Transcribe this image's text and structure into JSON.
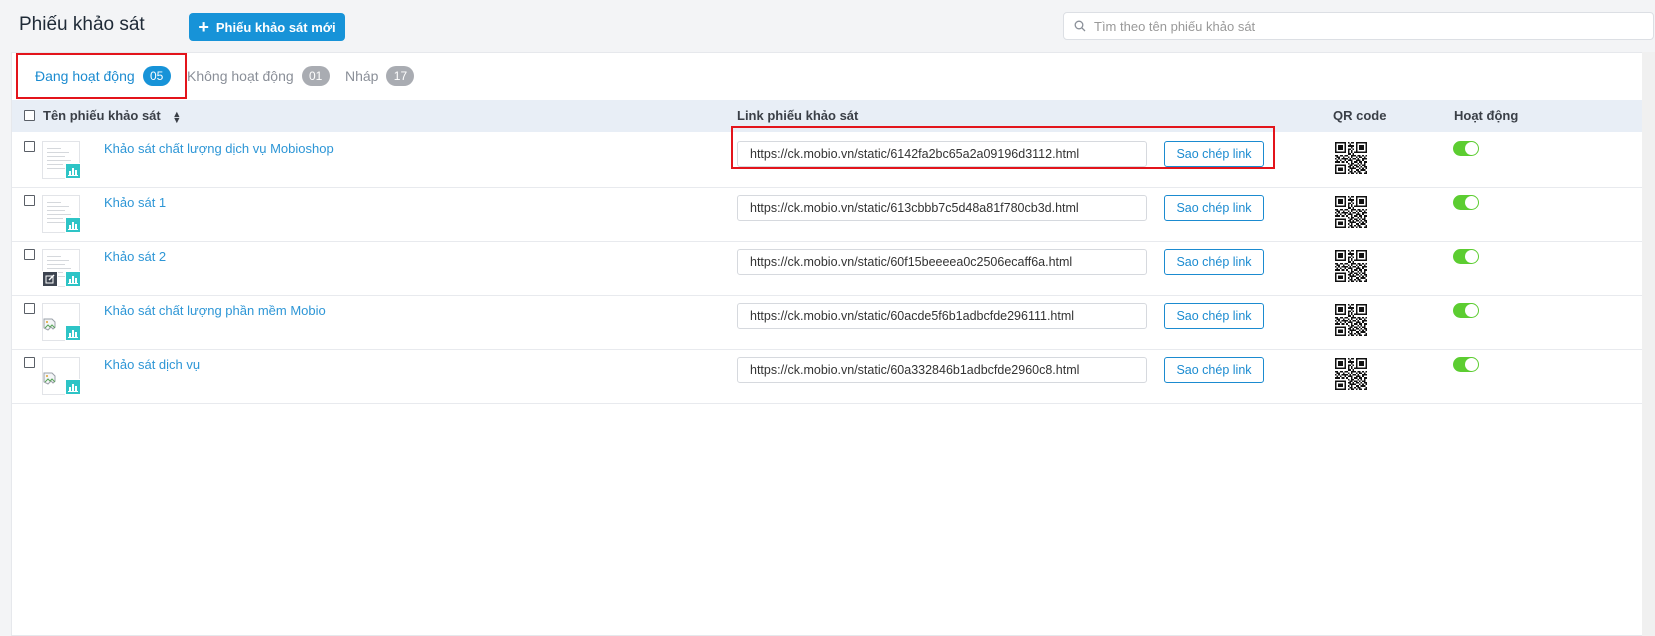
{
  "header": {
    "title": "Phiếu khảo sát",
    "new_button_label": "Phiếu khảo sát mới",
    "search_placeholder": "Tìm theo tên phiếu khảo sát"
  },
  "tabs": [
    {
      "label": "Đang hoạt động",
      "count": "05",
      "active": true
    },
    {
      "label": "Không hoạt động",
      "count": "01",
      "active": false
    },
    {
      "label": "Nháp",
      "count": "17",
      "active": false
    }
  ],
  "table": {
    "columns": {
      "name": "Tên phiếu khảo sát",
      "link": "Link phiếu khảo sát",
      "qr": "QR code",
      "active": "Hoạt động"
    },
    "copy_label": "Sao chép link",
    "rows": [
      {
        "name": "Khảo sát chất lượng dịch vụ Mobioshop",
        "link": "https://ck.mobio.vn/static/6142fa2bc65a2a09196d3112.html",
        "thumbnail": "preview",
        "active": true
      },
      {
        "name": "Khảo sát 1",
        "link": "https://ck.mobio.vn/static/613cbbb7c5d48a81f780cb3d.html",
        "thumbnail": "preview",
        "active": true
      },
      {
        "name": "Khảo sát 2",
        "link": "https://ck.mobio.vn/static/60f15beeeea0c2506ecaff6a.html",
        "thumbnail": "preview-edit",
        "active": true
      },
      {
        "name": "Khảo sát chất lượng phần mềm Mobio",
        "link": "https://ck.mobio.vn/static/60acde5f6b1adbcfde296111.html",
        "thumbnail": "broken-image",
        "active": true
      },
      {
        "name": "Khảo sát dịch vụ",
        "link": "https://ck.mobio.vn/static/60a332846b1adbcfde2960c8.html",
        "thumbnail": "broken-image",
        "active": true
      }
    ]
  },
  "colors": {
    "accent": "#1793d8",
    "link": "#2d96d6",
    "toggle_on": "#5ccd31",
    "chart_badge": "#2ec4c6",
    "highlight": "#e3141b"
  }
}
